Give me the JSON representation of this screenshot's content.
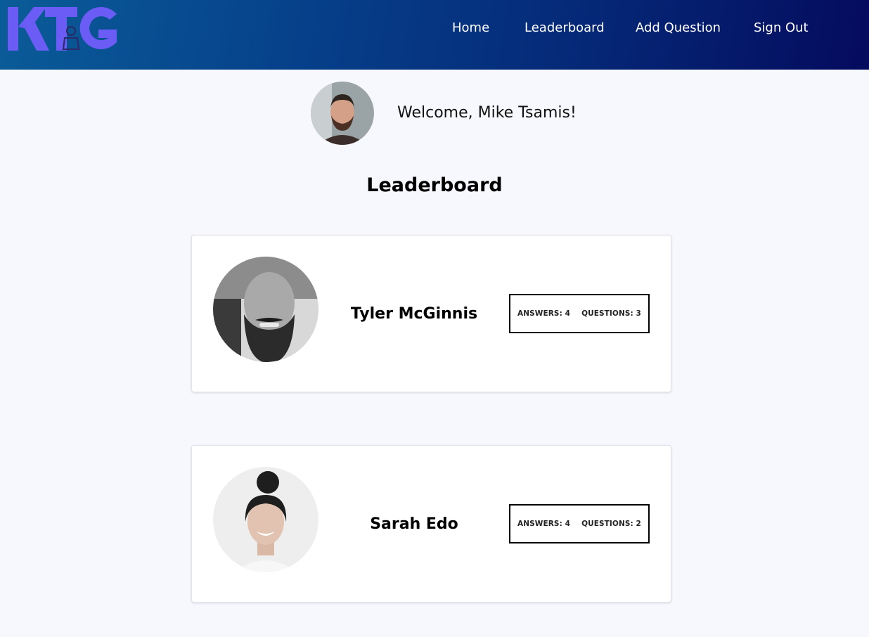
{
  "brand": {
    "logo_text": "KTG",
    "logo_color": "#6b5cf5"
  },
  "nav": {
    "home": "Home",
    "leaderboard": "Leaderboard",
    "add_question": "Add Question",
    "sign_out": "Sign Out"
  },
  "user": {
    "welcome": "Welcome, Mike Tsamis!"
  },
  "page": {
    "title": "Leaderboard"
  },
  "leaders": [
    {
      "name": "Tyler McGinnis",
      "answers": "ANSWERS: 4",
      "questions": "QUESTIONS: 3"
    },
    {
      "name": "Sarah Edo",
      "answers": "ANSWERS: 4",
      "questions": "QUESTIONS: 2"
    }
  ],
  "colors": {
    "header_start": "#0a5c98",
    "header_end": "#050b5e",
    "background": "#f7f8fd"
  }
}
